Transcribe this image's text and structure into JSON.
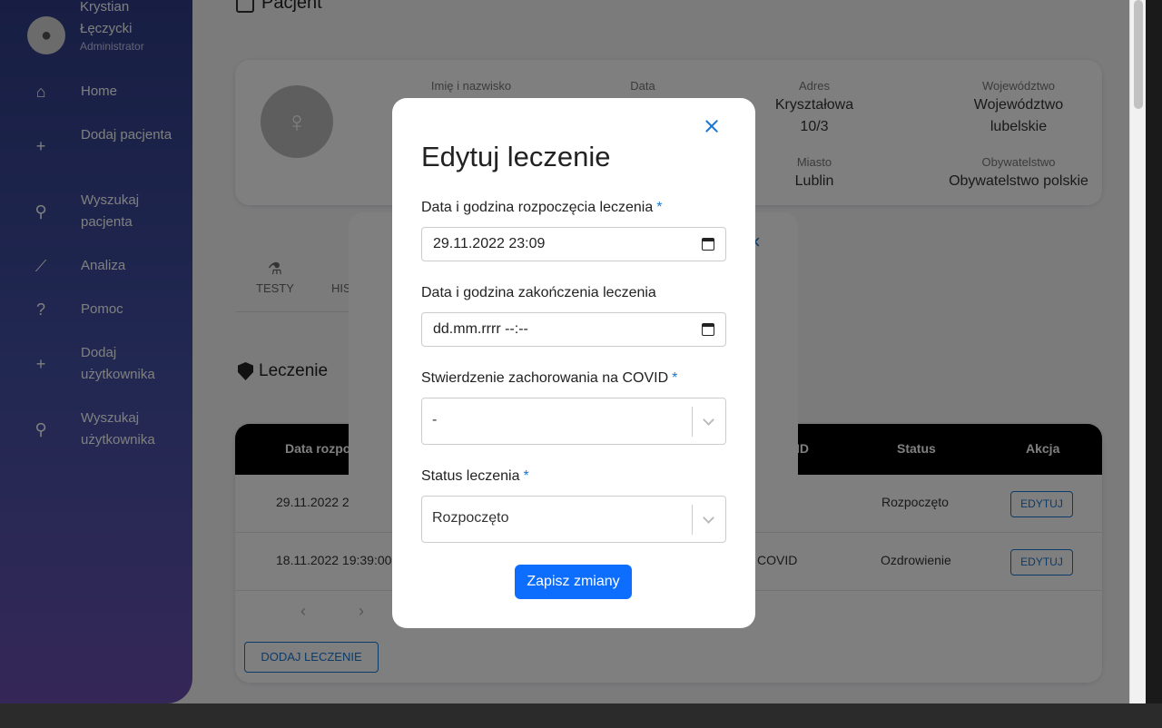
{
  "sidebar": {
    "user": {
      "name": "Krystian Łęczycki",
      "role": "Administrator"
    },
    "items": [
      {
        "label": "Home",
        "icon": "home-icon"
      },
      {
        "label": "Dodaj pacjenta",
        "icon": "add-person-icon"
      },
      {
        "label": "Wyszukaj pacjenta",
        "icon": "search-person-icon"
      },
      {
        "label": "Analiza",
        "icon": "analytics-icon"
      },
      {
        "label": "Pomoc",
        "icon": "help-icon"
      },
      {
        "label": "Dodaj użytkownika",
        "icon": "add-user-icon"
      },
      {
        "label": "Wyszukaj użytkownika",
        "icon": "search-icon"
      }
    ]
  },
  "page": {
    "title": "Pacjent"
  },
  "patient": {
    "labels": {
      "name": "Imię i nazwisko",
      "date": "Data",
      "address": "Adres",
      "voivodeship": "Województwo",
      "city": "Miasto",
      "citizenship": "Obywatelstwo"
    },
    "values": {
      "address": "Kryształowa 10/3",
      "voivodeship": "Województwo lubelskie",
      "city": "Lublin",
      "citizenship": "Obywatelstwo polskie"
    }
  },
  "tabs": [
    {
      "label": "TESTY"
    },
    {
      "label": "HIS"
    }
  ],
  "treatment": {
    "section_title": "Leczenie",
    "columns": [
      "Data rozpo",
      "ID",
      "Status",
      "Akcja"
    ],
    "rows": [
      {
        "date": "29.11.2022 2",
        "covid": "",
        "status": "Rozpoczęto",
        "action": "EDYTUJ"
      },
      {
        "date": "18.11.2022 19:39:00",
        "covid": "COVID",
        "status": "Ozdrowienie",
        "action": "EDYTUJ"
      }
    ],
    "add_button": "DODAJ LECZENIE"
  },
  "modal": {
    "title": "Edytuj leczenie",
    "fields": {
      "start": {
        "label": "Data i godzina rozpoczęcia leczenia",
        "required_mark": "*",
        "value": "29.11.2022 23:09"
      },
      "end": {
        "label": "Data i godzina zakończenia leczenia",
        "value": "dd.mm.rrrr --:--"
      },
      "covid": {
        "label": "Stwierdzenie zachorowania na COVID",
        "required_mark": "*",
        "value": "-"
      },
      "status": {
        "label": "Status leczenia",
        "required_mark": "*",
        "value": "Rozpoczęto"
      }
    },
    "save_label": "Zapisz zmiany"
  },
  "colors": {
    "primary": "#0d6efd",
    "accent": "#1976d2",
    "sidebar_top": "#2f3c86",
    "sidebar_bottom": "#6a4fb0"
  }
}
